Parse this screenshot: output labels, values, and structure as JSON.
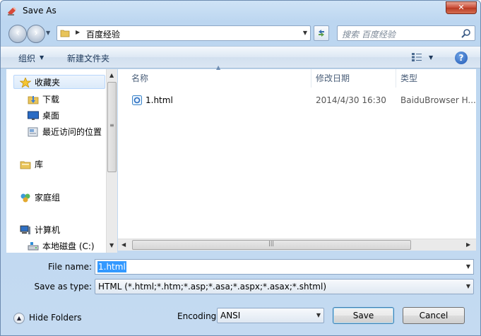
{
  "window": {
    "title": "Save As",
    "close_symbol": "✕"
  },
  "nav": {
    "back_symbol": "‹",
    "forward_symbol": "›",
    "address_path": "百度经验",
    "search_placeholder": "搜索 百度经验"
  },
  "toolbar": {
    "organize_label": "组织",
    "new_folder_label": "新建文件夹",
    "help_symbol": "?"
  },
  "sidebar": {
    "items": [
      {
        "label": "收藏夹",
        "icon": "star-icon"
      },
      {
        "label": "下载",
        "icon": "download-folder-icon"
      },
      {
        "label": "桌面",
        "icon": "desktop-icon"
      },
      {
        "label": "最近访问的位置",
        "icon": "recent-places-icon"
      },
      {
        "label": "库",
        "icon": "libraries-icon"
      },
      {
        "label": "家庭组",
        "icon": "homegroup-icon"
      },
      {
        "label": "计算机",
        "icon": "computer-icon"
      },
      {
        "label": "本地磁盘 (C:)",
        "icon": "drive-icon"
      }
    ]
  },
  "file_list": {
    "columns": [
      "名称",
      "修改日期",
      "类型"
    ],
    "rows": [
      {
        "name": "1.html",
        "date": "2014/4/30 16:30",
        "type": "BaiduBrowser H..."
      }
    ]
  },
  "form": {
    "file_name_label": "File name:",
    "file_name_value": "1.html",
    "save_type_label": "Save as type:",
    "save_type_value": "HTML (*.html;*.htm;*.asp;*.asa;*.aspx;*.asax;*.shtml)",
    "encoding_label": "Encoding:",
    "encoding_value": "ANSI"
  },
  "buttons": {
    "hide_folders": "Hide Folders",
    "save": "Save",
    "cancel": "Cancel"
  },
  "colors": {
    "selection": "#3399ff",
    "window_frame": "#bcd6f0"
  }
}
